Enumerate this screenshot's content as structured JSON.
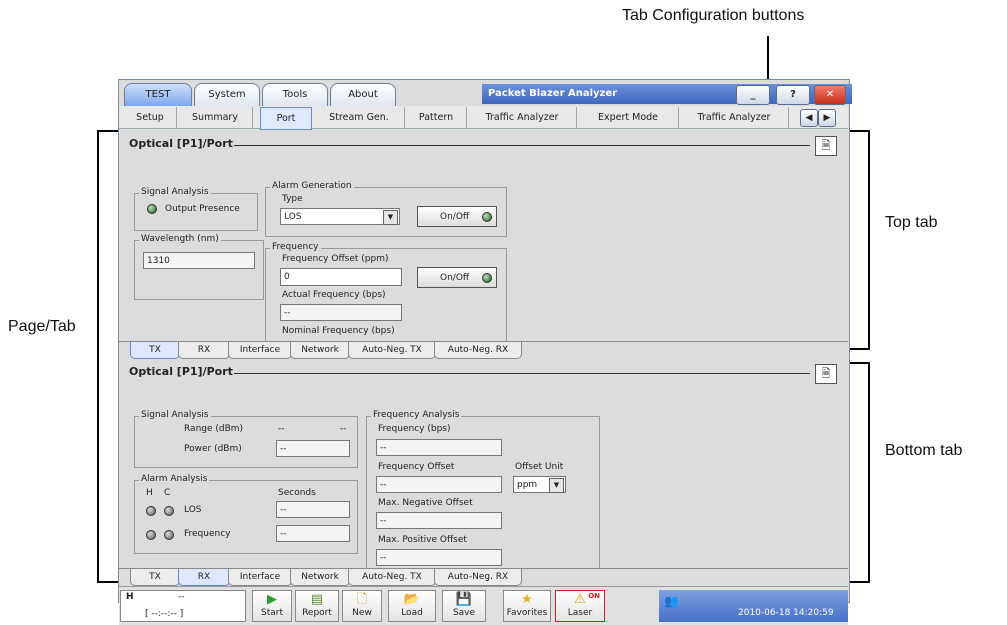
{
  "annotations": {
    "tab_config": "Tab Configuration buttons",
    "top_tab": "Top tab",
    "page_tab": "Page/Tab",
    "bottom_tab": "Bottom tab"
  },
  "window": {
    "main_tabs": [
      "TEST",
      "System",
      "Tools",
      "About"
    ],
    "title": "Packet Blazer Analyzer",
    "minimize": "_",
    "help": "?",
    "close": "✕"
  },
  "page_tabs": [
    "Setup",
    "Summary",
    "Port",
    "Stream Gen.",
    "Pattern",
    "Traffic Analyzer",
    "Expert Mode",
    "Traffic Analyzer"
  ],
  "top": {
    "title": "Optical [P1]/Port",
    "signal_analysis": {
      "legend": "Signal Analysis",
      "output_presence": "Output Presence"
    },
    "wavelength": {
      "legend": "Wavelength (nm)",
      "value": "1310"
    },
    "alarm_generation": {
      "legend": "Alarm Generation",
      "type_label": "Type",
      "type_value": "LOS",
      "onoff": "On/Off"
    },
    "frequency": {
      "legend": "Frequency",
      "offset_label": "Frequency Offset (ppm)",
      "offset_value": "0",
      "onoff": "On/Off",
      "actual_label": "Actual Frequency (bps)",
      "actual_value": "--",
      "nominal_label": "Nominal Frequency (bps)"
    },
    "subtabs": [
      "TX",
      "RX",
      "Interface",
      "Network",
      "Auto-Neg. TX",
      "Auto-Neg. RX"
    ]
  },
  "bottom": {
    "title": "Optical [P1]/Port",
    "signal_analysis": {
      "legend": "Signal Analysis",
      "range_label": "Range (dBm)",
      "range_v1": "--",
      "range_v2": "--",
      "power_label": "Power (dBm)",
      "power_value": "--"
    },
    "alarm_analysis": {
      "legend": "Alarm Analysis",
      "h": "H",
      "c": "C",
      "seconds": "Seconds",
      "los": "LOS",
      "los_value": "--",
      "frequency": "Frequency",
      "frequency_value": "--"
    },
    "frequency_analysis": {
      "legend": "Frequency Analysis",
      "freq_label": "Frequency (bps)",
      "freq_value": "--",
      "offset_label": "Frequency Offset",
      "offset_value": "--",
      "unit_label": "Offset Unit",
      "unit_value": "ppm",
      "maxneg_label": "Max. Negative Offset",
      "maxneg_value": "--",
      "maxpos_label": "Max. Positive Offset",
      "maxpos_value": "--"
    },
    "subtabs": [
      "TX",
      "RX",
      "Interface",
      "Network",
      "Auto-Neg. TX",
      "Auto-Neg. RX"
    ]
  },
  "status": {
    "line1_h": "H",
    "line1_v": "--",
    "line2": "[ --:--:-- ]",
    "datetime": "2010-06-18 14:20:59"
  },
  "toolbar": [
    "Start",
    "Report",
    "New",
    "Load",
    "Save",
    "Favorites",
    "Laser"
  ],
  "laser_on": "ON"
}
